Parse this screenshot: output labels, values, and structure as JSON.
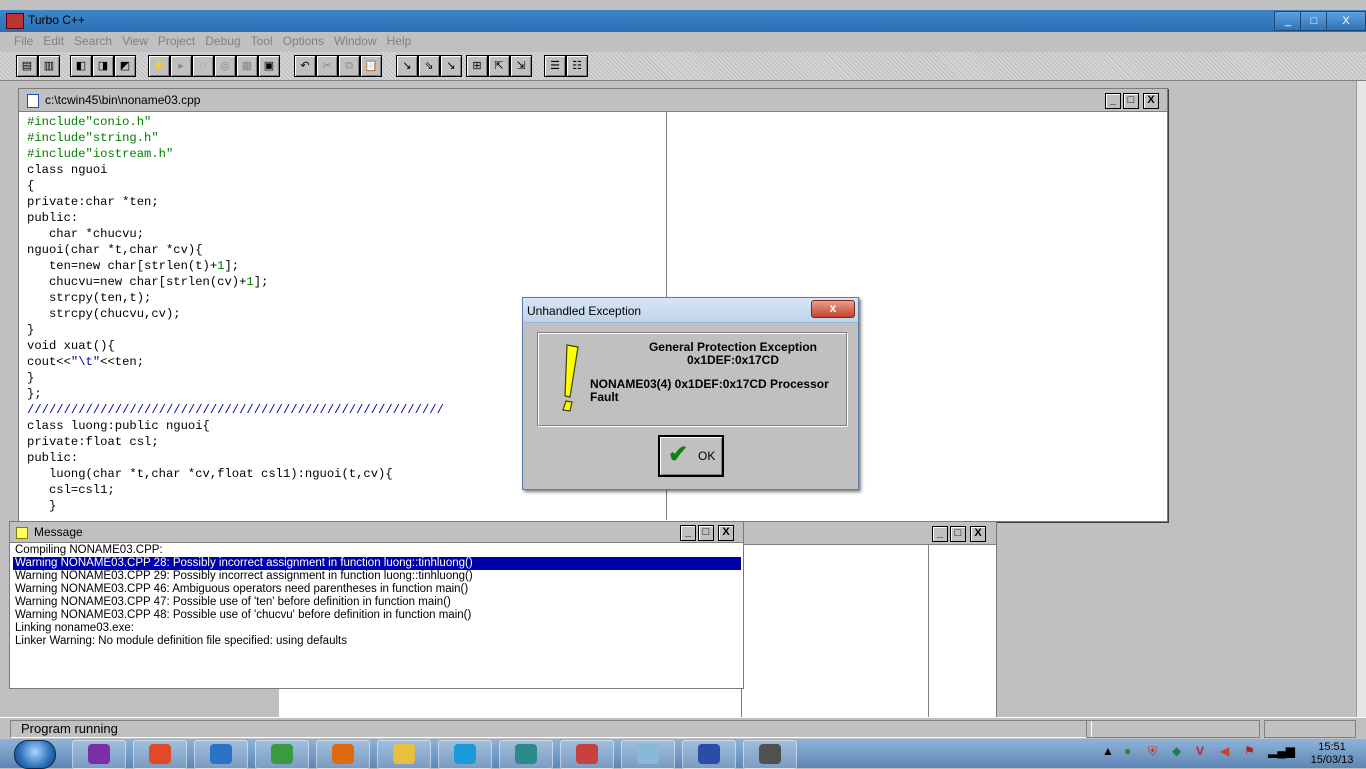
{
  "app": {
    "title": "Turbo C++",
    "blurred_subtitle": ""
  },
  "menu": [
    "File",
    "Edit",
    "Search",
    "View",
    "Project",
    "Debug",
    "Tool",
    "Options",
    "Window",
    "Help"
  ],
  "editor": {
    "path": "c:\\tcwin45\\bin\\noname03.cpp",
    "lines": [
      [
        {
          "t": "#include\"conio.h\"",
          "c": "g"
        }
      ],
      [
        {
          "t": "#include\"string.h\"",
          "c": "g"
        }
      ],
      [
        {
          "t": "#include\"iostream.h\"",
          "c": "g"
        }
      ],
      [
        {
          "t": "class nguoi",
          "c": ""
        }
      ],
      [
        {
          "t": "{",
          "c": ""
        }
      ],
      [
        {
          "t": "private:char *ten;",
          "c": ""
        }
      ],
      [
        {
          "t": "public:",
          "c": ""
        }
      ],
      [
        {
          "t": "   char *chucvu;",
          "c": ""
        }
      ],
      [
        {
          "t": "nguoi(char *t,char *cv){",
          "c": ""
        }
      ],
      [
        {
          "t": "   ten=new char[strlen(t)+",
          "c": ""
        },
        {
          "t": "1",
          "c": "g"
        },
        {
          "t": "];",
          "c": ""
        }
      ],
      [
        {
          "t": "   chucvu=new char[strlen(cv)+",
          "c": ""
        },
        {
          "t": "1",
          "c": "g"
        },
        {
          "t": "];",
          "c": ""
        }
      ],
      [
        {
          "t": "   strcpy(ten,t);",
          "c": ""
        }
      ],
      [
        {
          "t": "   strcpy(chucvu,cv);",
          "c": ""
        }
      ],
      [
        {
          "t": "}",
          "c": ""
        }
      ],
      [
        {
          "t": "void xuat(){",
          "c": ""
        }
      ],
      [
        {
          "t": "cout<<",
          "c": ""
        },
        {
          "t": "\"\\t\"",
          "c": "b"
        },
        {
          "t": "<<ten;",
          "c": ""
        }
      ],
      [
        {
          "t": "}",
          "c": ""
        }
      ],
      [
        {
          "t": "};",
          "c": ""
        }
      ],
      [
        {
          "t": "/////////////////////////////////////////////////////////",
          "c": "b"
        }
      ],
      [
        {
          "t": "class luong:public nguoi{",
          "c": ""
        }
      ],
      [
        {
          "t": "private:float csl;",
          "c": ""
        }
      ],
      [
        {
          "t": "public:",
          "c": ""
        }
      ],
      [
        {
          "t": "   luong(char *t,char *cv,float csl1):nguoi(t,cv){",
          "c": ""
        }
      ],
      [
        {
          "t": "   csl=csl1;",
          "c": ""
        }
      ],
      [
        {
          "t": "   }",
          "c": ""
        }
      ]
    ]
  },
  "message_window": {
    "title": "Message",
    "selected_index": 1,
    "lines": [
      "Compiling NONAME03.CPP:",
      "Warning NONAME03.CPP 28: Possibly incorrect assignment in function luong::tinhluong()",
      "Warning NONAME03.CPP 29: Possibly incorrect assignment in function luong::tinhluong()",
      "Warning NONAME03.CPP 46: Ambiguous operators need parentheses in function main()",
      "Warning NONAME03.CPP 47: Possible use of 'ten' before definition in function main()",
      "Warning NONAME03.CPP 48: Possible use of 'chucvu' before definition in function main()",
      "Linking noname03.exe:",
      "Linker Warning: No module definition file specified: using defaults"
    ]
  },
  "dialog": {
    "title": "Unhandled Exception",
    "close_label": "x",
    "heading": "General Protection Exception",
    "address": "0x1DEF:0x17CD",
    "detail": "NONAME03(4) 0x1DEF:0x17CD Processor Fault",
    "ok_label": "OK",
    "icon": "exclamation-icon"
  },
  "status": {
    "text": "Program running"
  },
  "window_controls": {
    "minimize": "_",
    "maximize": "□",
    "close": "X"
  },
  "taskbar": {
    "apps": [
      "yahoo-messenger-icon",
      "chrome-icon",
      "internet-explorer-icon",
      "network-icon",
      "media-player-icon",
      "file-explorer-icon",
      "skype-icon",
      "app-icon",
      "remote-icon",
      "notepad-icon",
      "word-icon",
      "turbo-cpp-icon"
    ],
    "clock_time": "15:51",
    "clock_date": "15/03/13"
  },
  "colors": {
    "selection": "#0000a8",
    "string_literal": "#008000",
    "comment": "#0000a8",
    "titlebar": "#2a6fb5"
  }
}
